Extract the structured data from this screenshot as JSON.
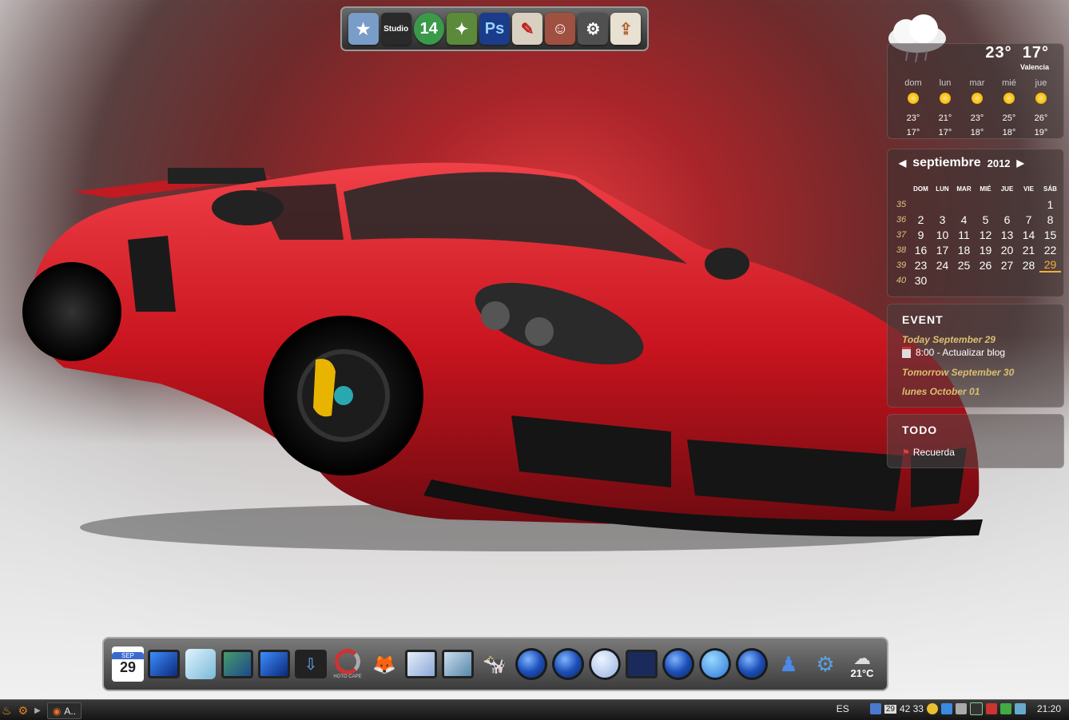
{
  "top_dock": {
    "items": [
      {
        "name": "favorites-star-icon",
        "glyph": "★",
        "color": "#7a9cc8"
      },
      {
        "name": "studio-icon",
        "glyph": "Studio",
        "color": "#2a2a2a"
      },
      {
        "name": "nero-14-icon",
        "glyph": "14",
        "color": "#3a9a4a"
      },
      {
        "name": "magic-wand-icon",
        "glyph": "✦",
        "color": "#5a8a3a"
      },
      {
        "name": "photoshop-icon",
        "glyph": "Ps",
        "color": "#1a3c8a"
      },
      {
        "name": "notepad-icon",
        "glyph": "✎",
        "color": "#d8d0c0"
      },
      {
        "name": "user-photo-icon",
        "glyph": "☺",
        "color": "#a05040"
      },
      {
        "name": "system-tool-icon",
        "glyph": "⚙",
        "color": "#505050"
      },
      {
        "name": "usb-drive-icon",
        "glyph": "⇪",
        "color": "#e8e0d0"
      }
    ]
  },
  "bottom_dock": {
    "calendar_icon": {
      "month": "SEP",
      "day": "29"
    },
    "hoto_cape_label": "HOTO CAPE",
    "weather_icon_temp": "21°C"
  },
  "weather": {
    "current_high": "23°",
    "current_low": "17°",
    "city": "Valencia",
    "forecast": [
      {
        "day": "dom",
        "high": "23°",
        "low": "17°"
      },
      {
        "day": "lun",
        "high": "21°",
        "low": "17°"
      },
      {
        "day": "mar",
        "high": "23°",
        "low": "18°"
      },
      {
        "day": "mié",
        "high": "25°",
        "low": "18°"
      },
      {
        "day": "jue",
        "high": "26°",
        "low": "19°"
      }
    ]
  },
  "calendar": {
    "month": "septiembre",
    "year": "2012",
    "dow": [
      "DOM",
      "LUN",
      "MAR",
      "MIÉ",
      "JUE",
      "VIE",
      "SÁB"
    ],
    "weeks": [
      {
        "wk": "35",
        "days": [
          "",
          "",
          "",
          "",
          "",
          "",
          "1"
        ]
      },
      {
        "wk": "36",
        "days": [
          "2",
          "3",
          "4",
          "5",
          "6",
          "7",
          "8"
        ]
      },
      {
        "wk": "37",
        "days": [
          "9",
          "10",
          "11",
          "12",
          "13",
          "14",
          "15"
        ]
      },
      {
        "wk": "38",
        "days": [
          "16",
          "17",
          "18",
          "19",
          "20",
          "21",
          "22"
        ]
      },
      {
        "wk": "39",
        "days": [
          "23",
          "24",
          "25",
          "26",
          "27",
          "28",
          "29"
        ]
      },
      {
        "wk": "40",
        "days": [
          "30",
          "",
          "",
          "",
          "",
          "",
          ""
        ]
      }
    ],
    "today": "29"
  },
  "event": {
    "title": "EVENT",
    "today_line": "Today September 29",
    "item": "8:00 - Actualizar blog",
    "tomorrow_line": "Tomorrow September 30",
    "next_line": "lunes October 01"
  },
  "todo": {
    "title": "TODO",
    "item": "Recuerda"
  },
  "taskbar": {
    "window_label": "A..",
    "language": "ES",
    "tray_text": "42 33",
    "calendar_day": "29",
    "clock": "21:20"
  }
}
